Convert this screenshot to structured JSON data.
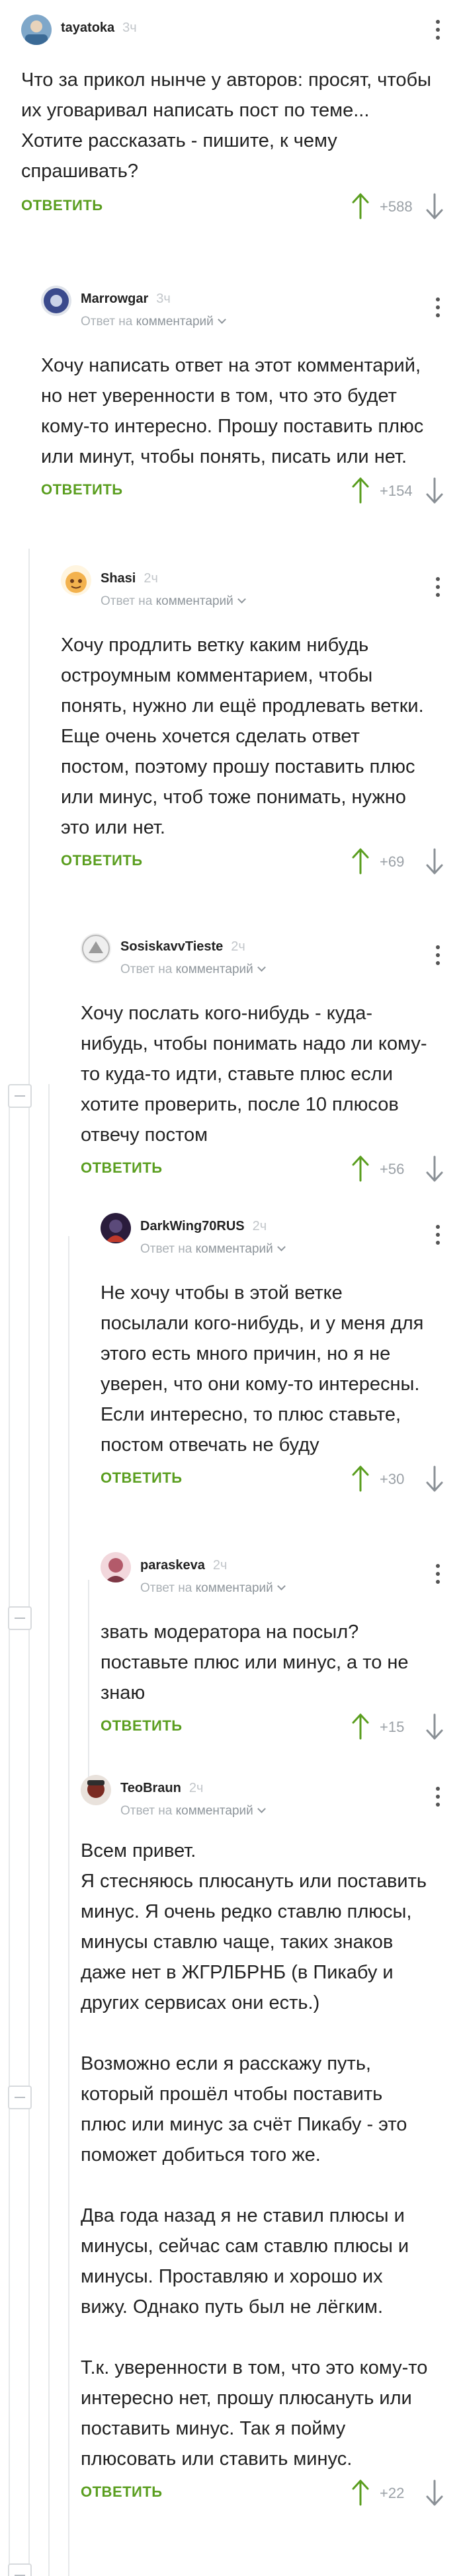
{
  "comments": [
    {
      "author": "tayatoka",
      "time": "3ч",
      "reply_prefix": "",
      "reply_target": "",
      "text": "Что за прикол нынче у авторов: просят, чтобы их уговаривал написать пост по теме...\nХотите рассказать - пишите, к чему спрашивать?",
      "reply_label": "ОТВЕТИТЬ",
      "score": "+588",
      "avatar_color": "#7fa7c9"
    },
    {
      "author": "Marrowgar",
      "time": "3ч",
      "reply_prefix": "Ответ на",
      "reply_target": "комментарий",
      "text": "Хочу написать ответ на этот комментарий, но нет уверенности в том, что это будет кому-то интересно. Прошу поставить плюс или минут, чтобы понять, писать или нет.",
      "reply_label": "ОТВЕТИТЬ",
      "score": "+154",
      "avatar_color": "#3a4a8c"
    },
    {
      "author": "Shasi",
      "time": "2ч",
      "reply_prefix": "Ответ на",
      "reply_target": "комментарий",
      "text": "Хочу продлить ветку каким нибудь остроумным комментарием, чтобы понять, нужно ли ещё продлевать ветки.\nЕще очень хочется сделать ответ постом, поэтому прошу поставить плюс или минус, чтоб тоже понимать, нужно это или нет.",
      "reply_label": "ОТВЕТИТЬ",
      "score": "+69",
      "avatar_color": "#f3b24e"
    },
    {
      "author": "SosiskavvTieste",
      "time": "2ч",
      "reply_prefix": "Ответ на",
      "reply_target": "комментарий",
      "text": "Хочу послать кого-нибудь - куда-нибудь, чтобы понимать надо ли кому-то куда-то идти, ставьте плюс если хотите проверить, после 10 плюсов отвечу постом",
      "reply_label": "ОТВЕТИТЬ",
      "score": "+56",
      "avatar_color": "#9a9a9a"
    },
    {
      "author": "DarkWing70RUS",
      "time": "2ч",
      "reply_prefix": "Ответ на",
      "reply_target": "комментарий",
      "text": "Не хочу чтобы в этой ветке посылали кого-нибудь, и у меня для этого есть много причин, но я не уверен, что они кому-то интересны. Если интересно, то плюс ставьте, постом отвечать не буду",
      "reply_label": "ОТВЕТИТЬ",
      "score": "+30",
      "avatar_color": "#2a1c3c"
    },
    {
      "author": "paraskeva",
      "time": "2ч",
      "reply_prefix": "Ответ на",
      "reply_target": "комментарий",
      "text": "звать модератора на посыл? поставьте плюс или минус, а то не знаю",
      "reply_label": "ОТВЕТИТЬ",
      "score": "+15",
      "avatar_color": "#b35a6a"
    },
    {
      "author": "TeoBraun",
      "time": "2ч",
      "reply_prefix": "Ответ на",
      "reply_target": "комментарий",
      "text": "Всем привет.\nЯ стесняюсь плюсануть или поставить минус. Я очень редко ставлю плюсы, минусы ставлю чаще, таких знаков даже нет в ЖГРЛБРНБ (в Пикабу и других сервисах они есть.)\n\nВозможно если я расскажу путь, который прошёл чтобы поставить плюс или минус за счёт Пикабу - это поможет добиться того же.\n\nДва года назад я не ставил плюсы и минусы, сейчас сам ставлю плюсы и минусы. Проставляю и хорошо их вижу. Однако путь был не лёгким.\n\nТ.к. уверенности в том, что это кому-то интересно нет, прошу плюсануть или поставить минус. Так я пойму плюсовать или ставить минус.",
      "reply_label": "ОТВЕТИТЬ",
      "score": "+22",
      "avatar_color": "#7a2b22"
    }
  ],
  "colors": {
    "accent_green": "#5a9e1f",
    "thread_line": "#e6e8ea",
    "muted_text": "#9aa0a6"
  },
  "icons": {
    "vote_up": "arrow-up-icon",
    "vote_down": "arrow-down-icon",
    "more": "more-vertical-icon",
    "collapse": "collapse-minus-icon",
    "dropdown": "chevron-down-icon"
  }
}
